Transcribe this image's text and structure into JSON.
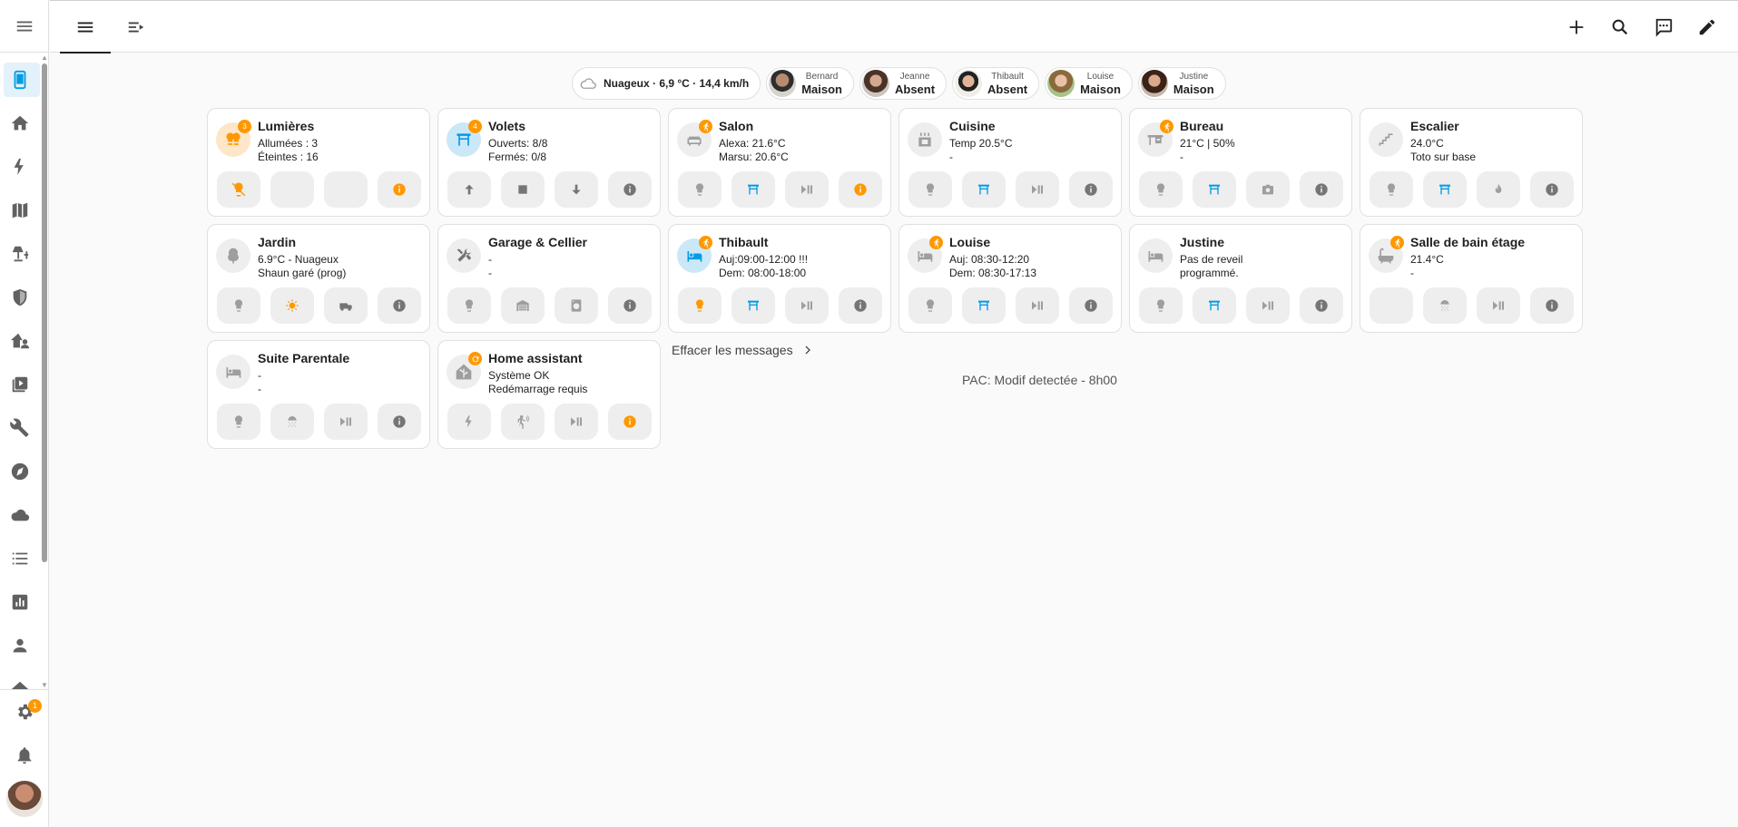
{
  "colors": {
    "accent": "#03a9f4",
    "warning": "#ff9800",
    "icon": "#616161",
    "active_bg": "#e3f1fb"
  },
  "sidebar": {
    "items": [
      {
        "icon": "tablet-icon",
        "active": true
      },
      {
        "icon": "home-icon"
      },
      {
        "icon": "lightning-icon"
      },
      {
        "icon": "map-icon"
      },
      {
        "icon": "lamp-icon"
      },
      {
        "icon": "shield-icon"
      },
      {
        "icon": "home-user-icon"
      },
      {
        "icon": "media-icon"
      },
      {
        "icon": "wrench-icon"
      },
      {
        "icon": "compass-icon"
      },
      {
        "icon": "cloud-icon"
      },
      {
        "icon": "list-icon"
      },
      {
        "icon": "chart-icon"
      },
      {
        "icon": "person-icon"
      },
      {
        "icon": "home-outline-icon"
      }
    ],
    "settings_badge": "1"
  },
  "weather": {
    "label": "Nuageux · 6,9 °C · 14,4 km/h",
    "icon": "cloud-icon"
  },
  "persons": [
    {
      "name": "Bernard",
      "state": "Maison"
    },
    {
      "name": "Jeanne",
      "state": "Absent"
    },
    {
      "name": "Thibault",
      "state": "Absent"
    },
    {
      "name": "Louise",
      "state": "Maison"
    },
    {
      "name": "Justine",
      "state": "Maison"
    }
  ],
  "cards": [
    {
      "title": "Lumières",
      "line1": "Allumées : 3",
      "line2": "Éteintes : 16",
      "badge": "3"
    },
    {
      "title": "Volets",
      "line1": "Ouverts: 8/8",
      "line2": "Fermés: 0/8",
      "badge": "4"
    },
    {
      "title": "Salon",
      "line1": "Alexa: 21.6°C",
      "line2": "Marsu: 20.6°C"
    },
    {
      "title": "Cuisine",
      "line1": "Temp 20.5°C",
      "line2": "-"
    },
    {
      "title": "Bureau",
      "line1": "21°C | 50%",
      "line2": "-"
    },
    {
      "title": "Escalier",
      "line1": "24.0°C",
      "line2": "Toto sur base"
    },
    {
      "title": "Jardin",
      "line1": "6.9°C - Nuageux",
      "line2": "Shaun garé (prog)"
    },
    {
      "title": "Garage & Cellier",
      "line1": "-",
      "line2": "-"
    },
    {
      "title": "Thibault",
      "line1": "Auj:09:00-12:00 !!!",
      "line2": "Dem: 08:00-18:00"
    },
    {
      "title": "Louise",
      "line1": "Auj: 08:30-12:20",
      "line2": "Dem: 08:30-17:13"
    },
    {
      "title": "Justine",
      "line1": "Pas de reveil",
      "line2": "programmé."
    },
    {
      "title": "Salle de bain étage",
      "line1": "21.4°C",
      "line2": "-"
    },
    {
      "title": "Suite Parentale",
      "line1": "-",
      "line2": "-"
    },
    {
      "title": "Home assistant",
      "line1": "Système OK",
      "line2": "Redémarrage requis"
    }
  ],
  "messages": {
    "clear_label": "Effacer les messages",
    "text": "PAC: Modif detectée - 8h00"
  }
}
